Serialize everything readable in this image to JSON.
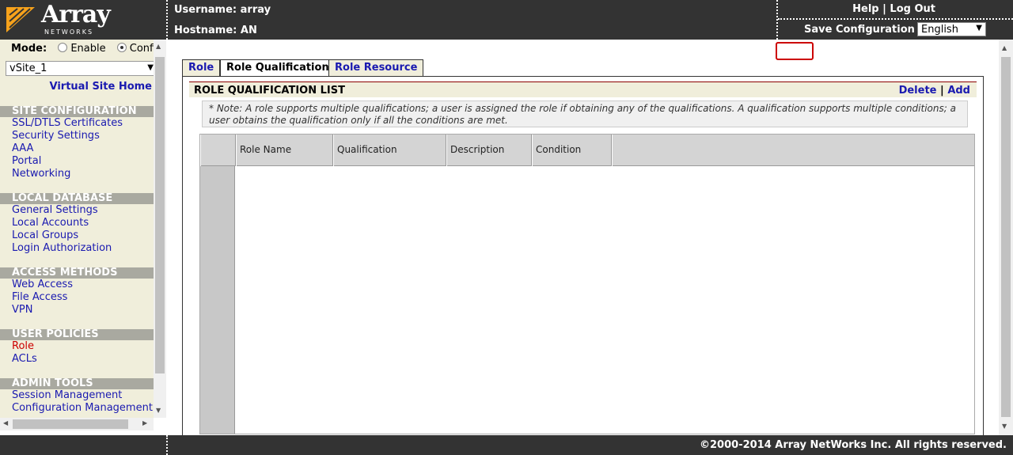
{
  "header": {
    "logo_text": "Array",
    "logo_subtext": "NETWORKS",
    "username_label": "Username:",
    "username": "array",
    "hostname_label": "Hostname:",
    "hostname": "AN",
    "help_label": "Help",
    "logout_label": "Log Out",
    "link_separator": "|",
    "save_config_label": "Save Configuration",
    "language": "English"
  },
  "sidebar": {
    "mode_label": "Mode:",
    "mode_enable": "Enable",
    "mode_config": "Config",
    "site_select": "vSite_1",
    "virtual_site_home": "Virtual Site Home",
    "sections": [
      {
        "title": "SITE CONFIGURATION",
        "items": [
          "SSL/DTLS Certificates",
          "Security Settings",
          "AAA",
          "Portal",
          "Networking"
        ]
      },
      {
        "title": "LOCAL DATABASE",
        "items": [
          "General Settings",
          "Local Accounts",
          "Local Groups",
          "Login Authorization"
        ]
      },
      {
        "title": "ACCESS METHODS",
        "items": [
          "Web Access",
          "File Access",
          "VPN"
        ]
      },
      {
        "title": "USER POLICIES",
        "items": [
          "Role",
          "ACLs"
        ]
      },
      {
        "title": "ADMIN TOOLS",
        "items": [
          "Session Management",
          "Configuration Management"
        ]
      }
    ],
    "active_item": "Role"
  },
  "tabs": [
    "Role",
    "Role Qualification",
    "Role Resource"
  ],
  "active_tab": "Role Qualification",
  "list": {
    "title": "ROLE QUALIFICATION LIST",
    "delete_label": "Delete",
    "separator": "|",
    "add_label": "Add",
    "note": "* Note: A role supports multiple qualifications; a user is assigned the role if obtaining any of the qualifications. A qualification supports multiple conditions; a user obtains the qualification only if all the conditions are met.",
    "columns": [
      "Role Name",
      "Qualification",
      "Description",
      "Condition"
    ],
    "rows": []
  },
  "footer": {
    "copyright": "©2000-2014 Array NetWorks Inc. All rights reserved."
  },
  "colors": {
    "header_bg": "#333333",
    "sidebar_bg": "#f0eedb",
    "section_head_bg": "#a9a9a0",
    "link": "#1a1ab0",
    "active_link": "#cc0000",
    "highlight": "#cc0000"
  }
}
